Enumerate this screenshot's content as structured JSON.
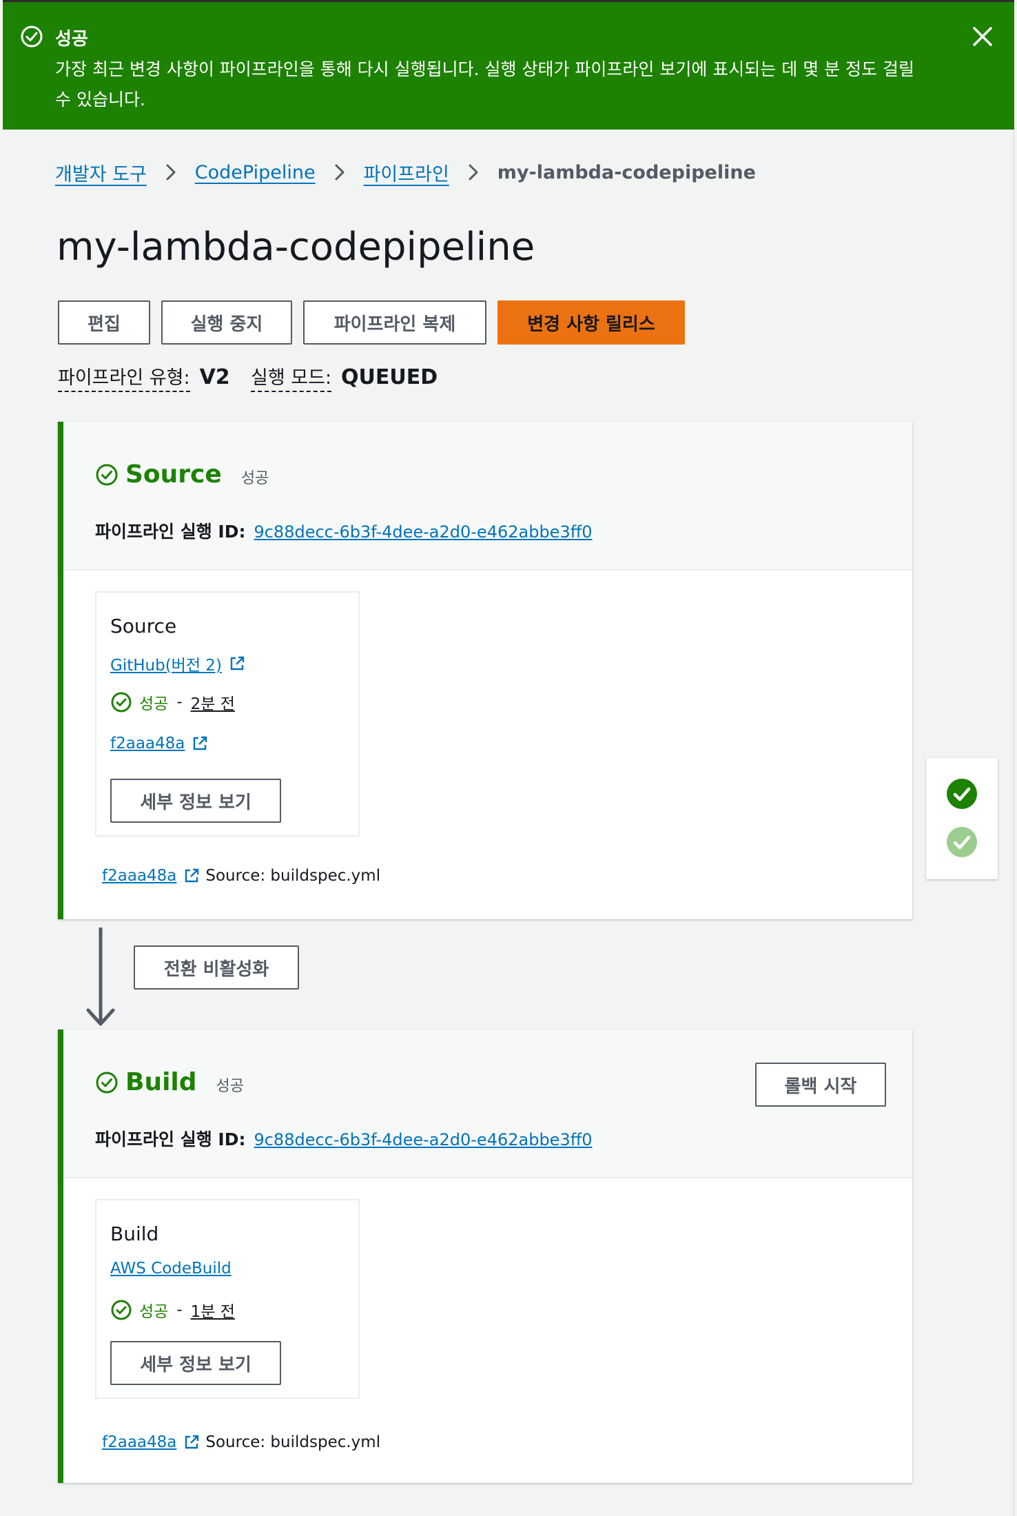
{
  "flash": {
    "title": "성공",
    "message": "가장 최근 변경 사항이 파이프라인을 통해 다시 실행됩니다. 실행 상태가 파이프라인 보기에 표시되는 데 몇 분 정도 걸릴 수 있습니다."
  },
  "breadcrumb": {
    "items": [
      "개발자 도구",
      "CodePipeline",
      "파이프라인"
    ],
    "current": "my-lambda-codepipeline"
  },
  "page_title": "my-lambda-codepipeline",
  "actions": {
    "edit": "편집",
    "stop": "실행 중지",
    "clone": "파이프라인 복제",
    "release": "변경 사항 릴리스"
  },
  "meta": {
    "type_label": "파이프라인 유형:",
    "type_value": "V2",
    "mode_label": "실행 모드:",
    "mode_value": "QUEUED"
  },
  "transition_button": "전환 비활성화",
  "stages": [
    {
      "name": "Source",
      "status": "성공",
      "exec_label": "파이프라인 실행 ID:",
      "exec_id": "9c88decc-6b3f-4dee-a2d0-e462abbe3ff0",
      "action": {
        "name": "Source",
        "provider": "GitHub(버전 2)",
        "status": "성공",
        "dash": "-",
        "time": "2분 전",
        "commit": "f2aaa48a",
        "details_button": "세부 정보 보기"
      },
      "footer_commit": "f2aaa48a",
      "footer_source": "Source: buildspec.yml"
    },
    {
      "name": "Build",
      "status": "성공",
      "exec_label": "파이프라인 실행 ID:",
      "exec_id": "9c88decc-6b3f-4dee-a2d0-e462abbe3ff0",
      "rollback_button": "롤백 시작",
      "action": {
        "name": "Build",
        "provider": "AWS CodeBuild",
        "status": "성공",
        "dash": "-",
        "time": "1분 전",
        "details_button": "세부 정보 보기"
      },
      "footer_commit": "f2aaa48a",
      "footer_source": "Source: buildspec.yml"
    }
  ],
  "colors": {
    "success": "#1d8102",
    "link": "#0073bb",
    "primary": "#ec7211"
  }
}
